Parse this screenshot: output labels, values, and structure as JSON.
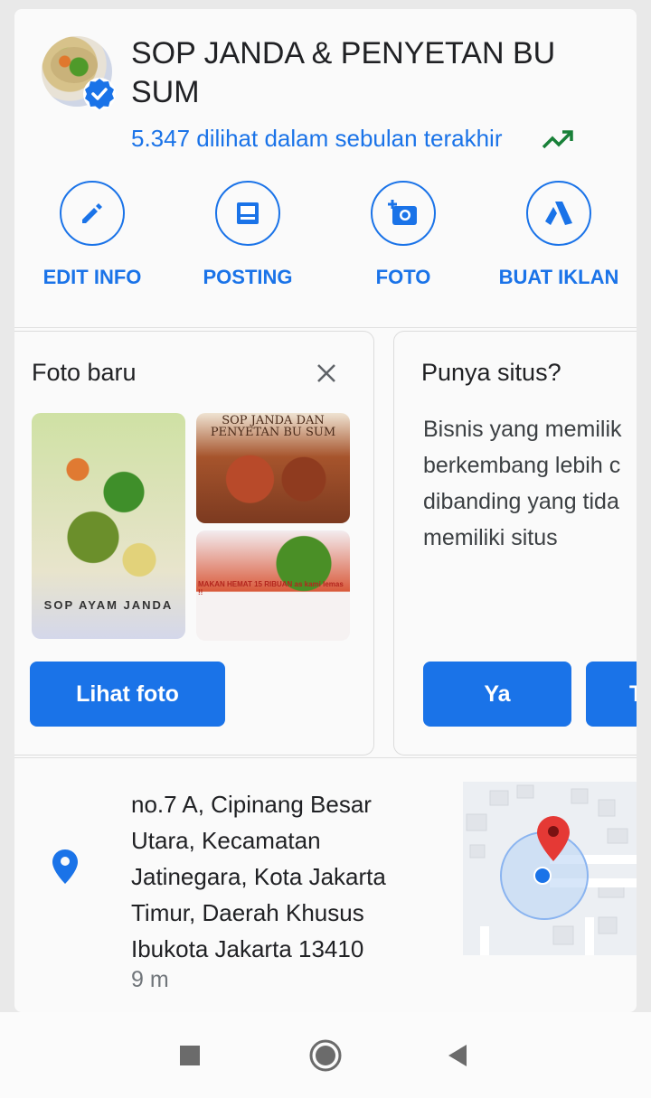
{
  "business": {
    "name": "SOP JANDA & PENYETAN BU SUM",
    "views": "5.347 dilihat dalam sebulan terakhir",
    "accent_color": "#1a73e8",
    "trend_color": "#188038"
  },
  "actions": [
    {
      "label": "EDIT INFO",
      "icon": "pencil-icon"
    },
    {
      "label": "POSTING",
      "icon": "post-icon"
    },
    {
      "label": "FOTO",
      "icon": "add-photo-icon"
    },
    {
      "label": "BUAT IKLAN",
      "icon": "ads-icon"
    }
  ],
  "photo_card": {
    "title": "Foto baru",
    "button": "Lihat foto",
    "photo_captions": [
      "SOP AYAM JANDA",
      "SOP JANDA DAN PENYETAN BU SUM",
      "MAKAN HEMAT 15 RIBUAN as kami lemas !!"
    ]
  },
  "site_card": {
    "title": "Punya situs?",
    "text_lines": [
      "Bisnis yang memilik",
      "berkembang lebih c",
      "dibanding yang tida",
      "memiliki situs"
    ],
    "button_yes": "Ya",
    "button_no": "T"
  },
  "location": {
    "address": "no.7 A, Cipinang Besar Utara, Kecamatan Jatinegara, Kota Jakarta Timur, Daerah Khusus Ibukota Jakarta 13410",
    "distance": "9 m"
  },
  "navbar": {
    "buttons": [
      "recent-apps",
      "home",
      "back"
    ]
  }
}
